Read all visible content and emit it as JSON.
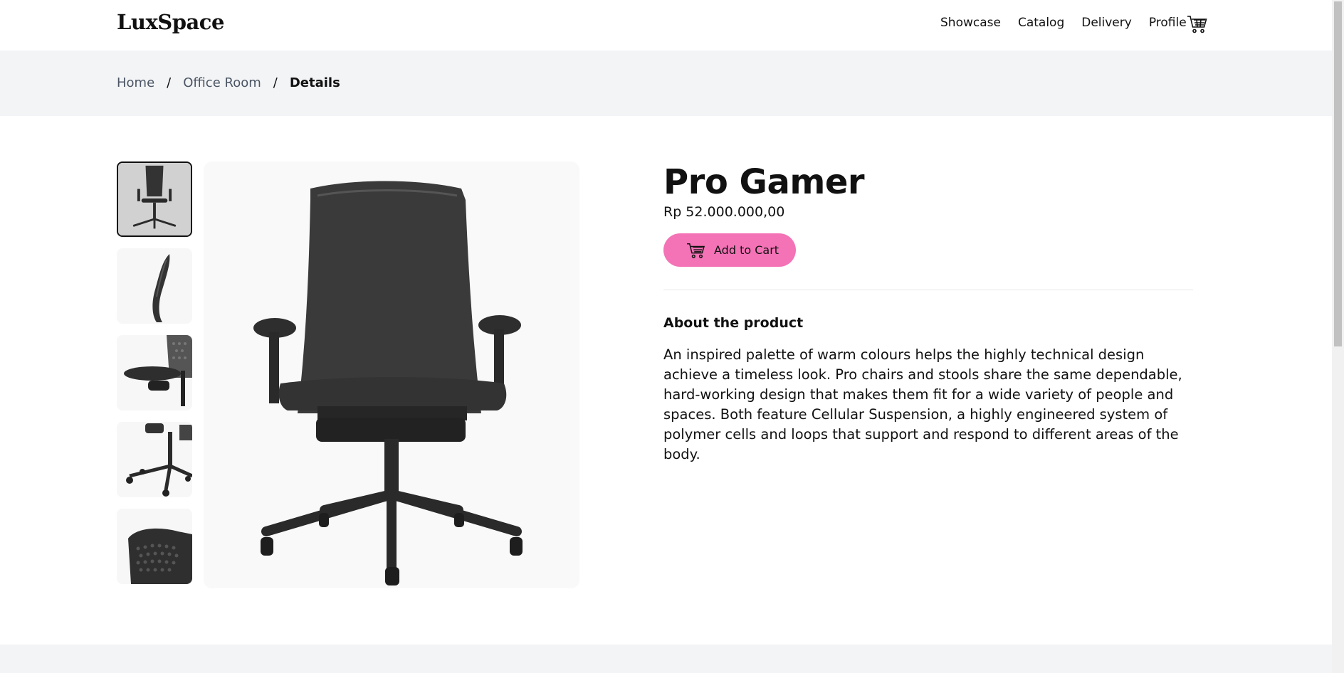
{
  "brand": {
    "prefix": "Lux",
    "highlight": "S",
    "suffix": "pace",
    "accent_color": "#f9a8d4"
  },
  "nav": {
    "items": [
      "Showcase",
      "Catalog",
      "Delivery",
      "Profile"
    ],
    "cart_icon": "cart-icon"
  },
  "breadcrumb": {
    "home": "Home",
    "category": "Office Room",
    "current": "Details",
    "separator": "/"
  },
  "product": {
    "title": "Pro Gamer",
    "price": "Rp 52.000.000,00",
    "add_to_cart_label": "Add to Cart",
    "button_color": "#f472b6",
    "about_heading": "About the product",
    "description": "An inspired palette of warm colours helps the highly technical design achieve a timeless look. Pro chairs and stools share the same dependable, hard-working design that makes them fit for a wide variety of people and spaces. Both feature Cellular Suspension, a highly engineered system of polymer cells and loops that support and respond to different areas of the body."
  },
  "gallery": {
    "thumbnails": [
      "chair-front",
      "chair-side-profile",
      "chair-seat-detail",
      "chair-base-detail",
      "chair-back-mesh"
    ],
    "active_index": 0
  }
}
